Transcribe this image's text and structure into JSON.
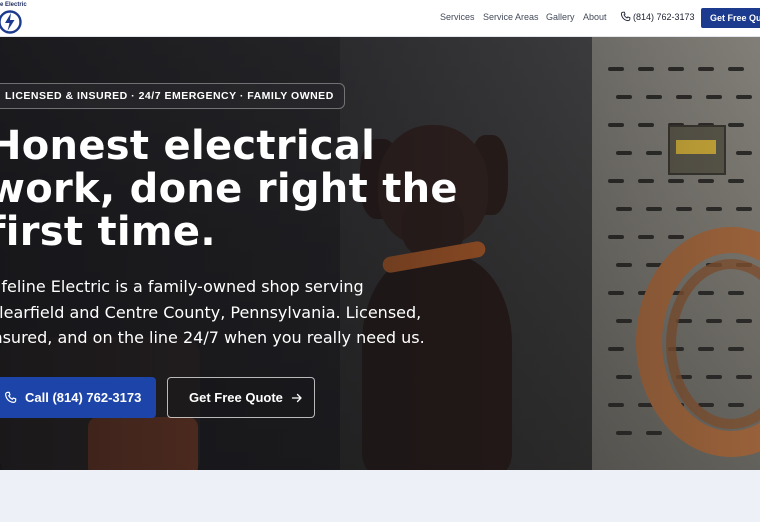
{
  "brand": {
    "name": "Lifeline Electric",
    "visible_name": "e Electric",
    "accent": "#1c3b8f"
  },
  "nav": {
    "links": [
      "Services",
      "Service Areas",
      "Gallery",
      "About"
    ],
    "phone": "(814) 762-3173",
    "cta": "Get Free Quote"
  },
  "hero": {
    "badge": "LICENSED & INSURED · 24/7 EMERGENCY · FAMILY OWNED",
    "headline": "Honest electrical work, done right the first time.",
    "subtext": "Lifeline Electric is a family-owned shop serving Clearfield and Centre County, Pennsylvania. Licensed, insured, and on the line 24/7 when you really need us.",
    "call_button": "Call (814) 762-3173",
    "quote_button": "Get Free Quote"
  },
  "icons": {
    "logo": "lightning-bolt-logo",
    "phone": "phone-icon",
    "arrow": "arrow-right-icon"
  }
}
